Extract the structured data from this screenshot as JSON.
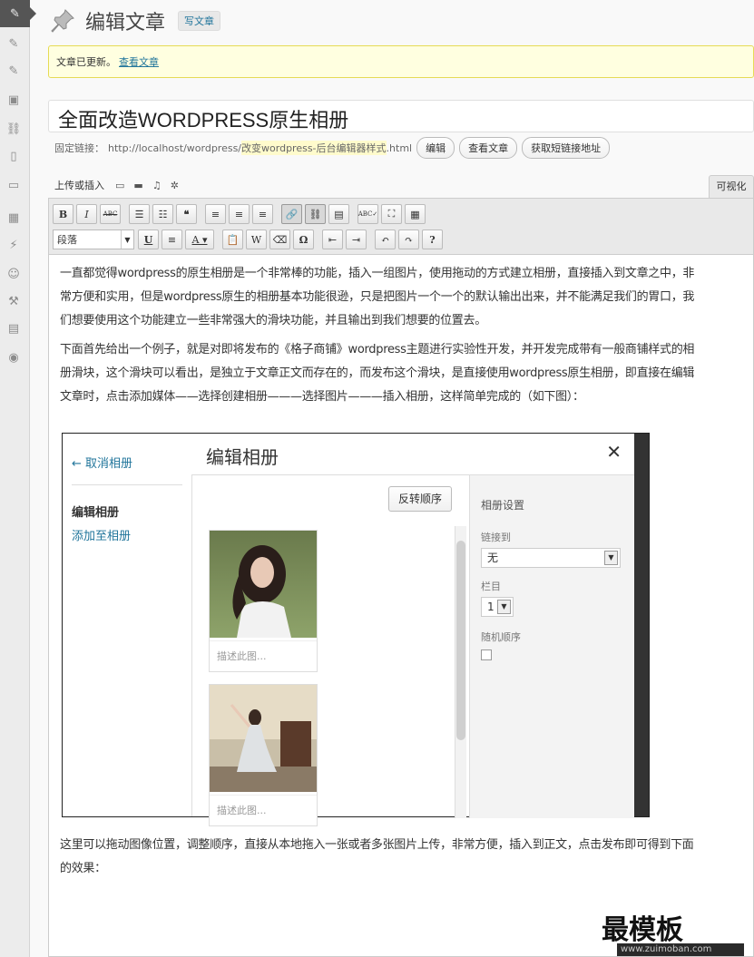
{
  "page": {
    "title": "编辑文章",
    "add_new_label": "写文章"
  },
  "notice": {
    "text": "文章已更新。",
    "link": "查看文章"
  },
  "post": {
    "title": "全面改造WORDPRESS原生相册"
  },
  "permalink": {
    "label": "固定链接：",
    "url_base": "http://localhost/wordpress/",
    "url_slug": "改变wordpress-后台编辑器样式",
    "url_suffix": ".html",
    "edit_button": "编辑",
    "view_button": "查看文章",
    "shortlink_button": "获取短链接地址"
  },
  "media": {
    "upload_insert_label": "上传或插入",
    "visual_tab": "可视化"
  },
  "toolbar": {
    "format_select": "段落"
  },
  "content": {
    "paragraph_1": "一直都觉得wordpress的原生相册是一个非常棒的功能，插入一组图片，使用拖动的方式建立相册，直接插入到文章之中，非常方便和实用，但是wordpress原生的相册基本功能很逊，只是把图片一个一个的默认输出出来，并不能满足我们的胃口，我们想要使用这个功能建立一些非常强大的滑块功能，并且输出到我们想要的位置去。",
    "paragraph_2": "下面首先给出一个例子，就是对即将发布的《格子商铺》wordpress主题进行实验性开发，并开发完成带有一般商铺样式的相册滑块，这个滑块可以看出，是独立于文章正文而存在的，而发布这个滑块，是直接使用wordpress原生相册，即直接在编辑文章时，点击添加媒体——选择创建相册———选择图片———插入相册，这样简单完成的（如下图）：",
    "paragraph_3": "这里可以拖动图像位置，调整顺序，直接从本地拖入一张或者多张图片上传，非常方便，插入到正文，点击发布即可得到下面的效果："
  },
  "gallery_dialog": {
    "cancel": "← 取消相册",
    "edit_gallery": "编辑相册",
    "add_to_gallery": "添加至相册",
    "title": "编辑相册",
    "close": "✕",
    "reverse_order": "反转顺序",
    "caption_placeholder": "描述此图...",
    "settings_title": "相册设置",
    "link_to_label": "链接到",
    "link_to_value": "无",
    "columns_label": "栏目",
    "columns_value": "1",
    "random_order_label": "随机顺序"
  },
  "watermark": {
    "text": "最模板",
    "url": "www.zuimoban.com"
  }
}
